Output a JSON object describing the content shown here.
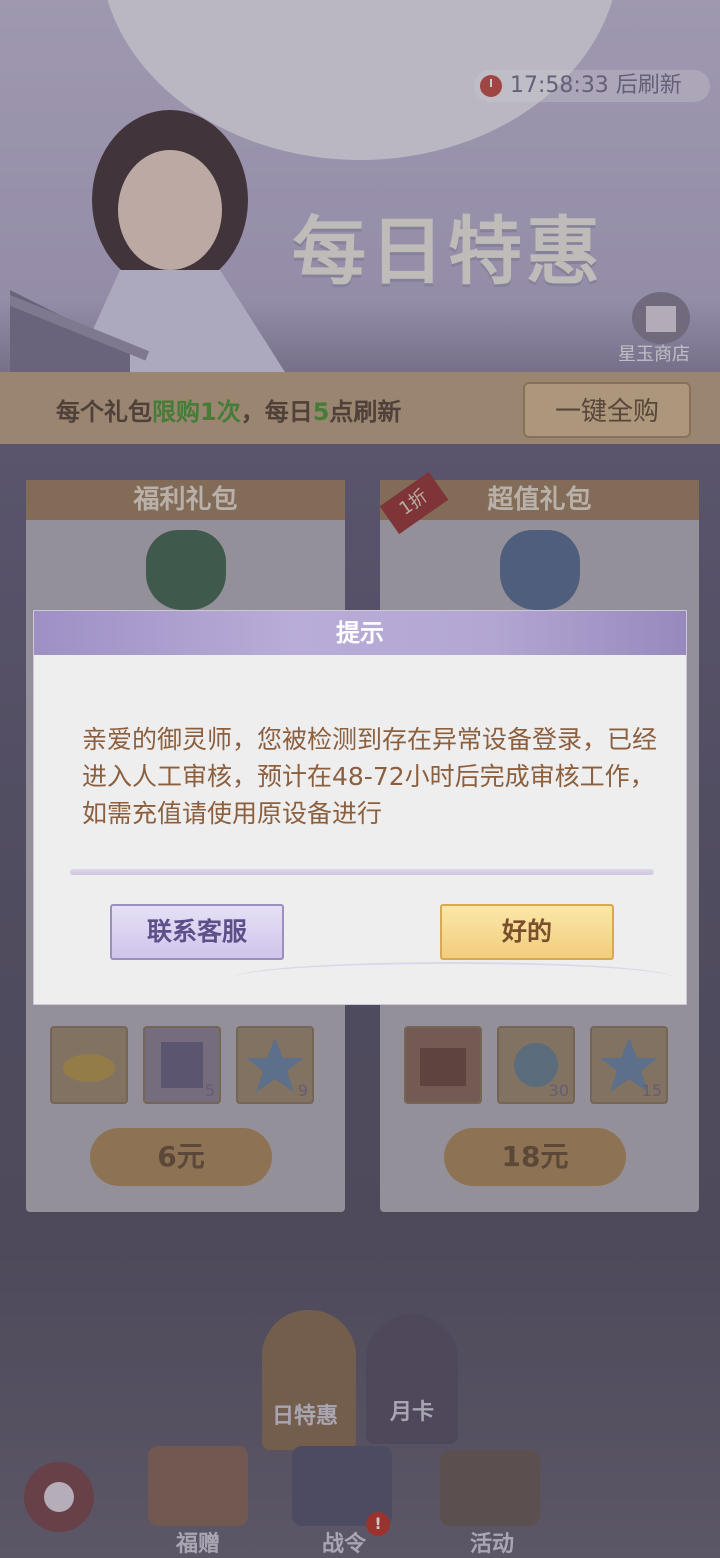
{
  "header": {
    "timer_text": "17:58:33 后刷新",
    "title": "每日特惠",
    "shop_label": "星玉商店"
  },
  "banner": {
    "text_part1": "每个礼包",
    "text_highlight1": "限购1次",
    "text_part2": "，每日",
    "text_highlight2": "5",
    "text_part3": "点刷新",
    "buy_all_label": "一键全购"
  },
  "cards": [
    {
      "title": "福利礼包",
      "ribbon": "",
      "price": "6元",
      "items": [
        {
          "icon": "gold-ingots-icon",
          "count": ""
        },
        {
          "icon": "book-icon",
          "count": "5"
        },
        {
          "icon": "star-icon",
          "count": "9"
        }
      ]
    },
    {
      "title": "超值礼包",
      "ribbon": "1折",
      "price": "18元",
      "items": [
        {
          "icon": "chest-icon",
          "count": ""
        },
        {
          "icon": "orb-icon",
          "count": "30"
        },
        {
          "icon": "star-icon",
          "count": "15"
        }
      ]
    }
  ],
  "side_tabs": [
    {
      "label": "日特惠"
    },
    {
      "label": "月卡"
    }
  ],
  "bottom_nav": [
    {
      "label": "福赠"
    },
    {
      "label": "战令",
      "badge": "!"
    },
    {
      "label": "活动"
    }
  ],
  "modal": {
    "title": "提示",
    "message": "亲爱的御灵师，您被检测到存在异常设备登录，已经进入人工审核，预计在48-72小时后完成审核工作，如需充值请使用原设备进行",
    "contact_button": "联系客服",
    "ok_button": "好的"
  },
  "colors": {
    "modal_header": "#b3a6d3",
    "message_text": "#8c5f3e",
    "ok_button": "#f2cd7d",
    "contact_button": "#cfc4ea"
  }
}
